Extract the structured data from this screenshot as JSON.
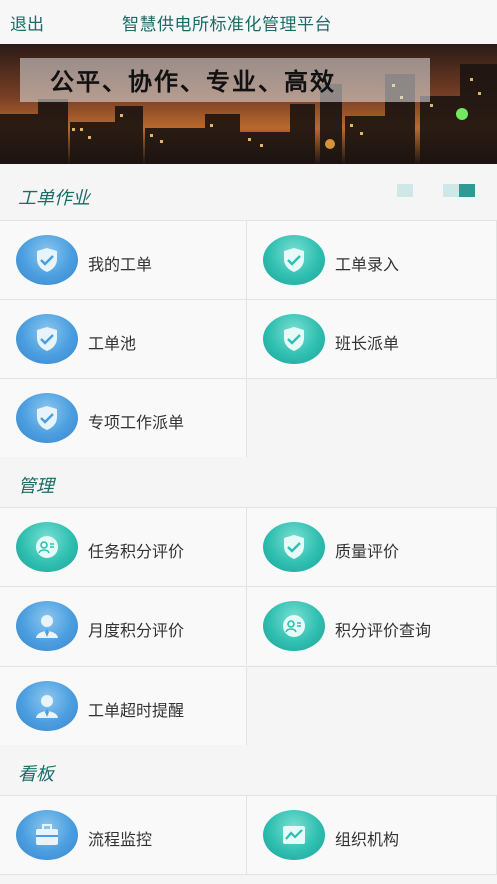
{
  "header": {
    "logout_label": "退出",
    "title": "智慧供电所标准化管理平台"
  },
  "banner": {
    "slogan": "公平、协作、专业、高效"
  },
  "sections": [
    {
      "title": "工单作业",
      "items": [
        {
          "label": "我的工单",
          "icon": "shield-check-icon"
        },
        {
          "label": "工单录入",
          "icon": "shield-check-icon"
        },
        {
          "label": "工单池",
          "icon": "shield-check-icon"
        },
        {
          "label": "班长派单",
          "icon": "shield-check-icon"
        },
        {
          "label": "专项工作派单",
          "icon": "shield-check-icon"
        }
      ]
    },
    {
      "title": "管理",
      "items": [
        {
          "label": "任务积分评价",
          "icon": "user-card-icon"
        },
        {
          "label": "质量评价",
          "icon": "shield-check-icon"
        },
        {
          "label": "月度积分评价",
          "icon": "person-icon"
        },
        {
          "label": "积分评价查询",
          "icon": "user-card-icon"
        },
        {
          "label": "工单超时提醒",
          "icon": "person-icon"
        }
      ]
    },
    {
      "title": "看板",
      "items": [
        {
          "label": "流程监控",
          "icon": "briefcase-icon"
        },
        {
          "label": "组织机构",
          "icon": "trend-chart-icon"
        }
      ]
    }
  ],
  "colors": {
    "accent_teal": "#1b6b66",
    "icon_blue": "#4a9ee0",
    "icon_teal": "#2fbfb0"
  }
}
